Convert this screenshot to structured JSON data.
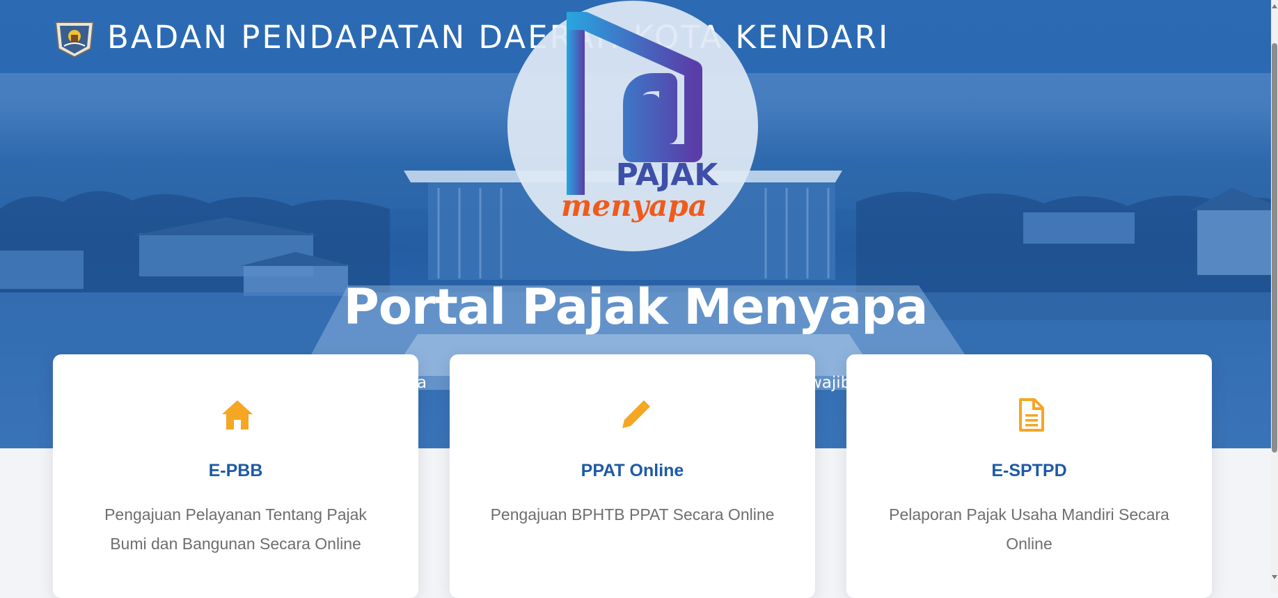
{
  "header": {
    "agency_name": "BADAN PENDAPATAN DAERAH KOTA KENDARI",
    "emblem_icon": "city-emblem-icon"
  },
  "hero": {
    "logo_icon": "pajak-menyapa-logo-icon",
    "logo_text_top": "PAJAK",
    "logo_text_bottom": "menyapa",
    "title": "Portal Pajak Menyapa",
    "subtitle_left": "jua",
    "subtitle_right": "wajib"
  },
  "services": [
    {
      "icon": "home-icon",
      "title": "E-PBB",
      "description": "Pengajuan Pelayanan Tentang Pajak Bumi dan Bangunan Secara Online"
    },
    {
      "icon": "pencil-icon",
      "title": "PPAT Online",
      "description": "Pengajuan BPHTB PPAT Secara Online"
    },
    {
      "icon": "document-icon",
      "title": "E-SPTPD",
      "description": "Pelaporan Pajak Usaha Mandiri Secara Online"
    }
  ],
  "colors": {
    "brand_blue": "#1d5aa6",
    "icon_amber": "#f5a623",
    "logo_orange": "#f05a1a"
  }
}
